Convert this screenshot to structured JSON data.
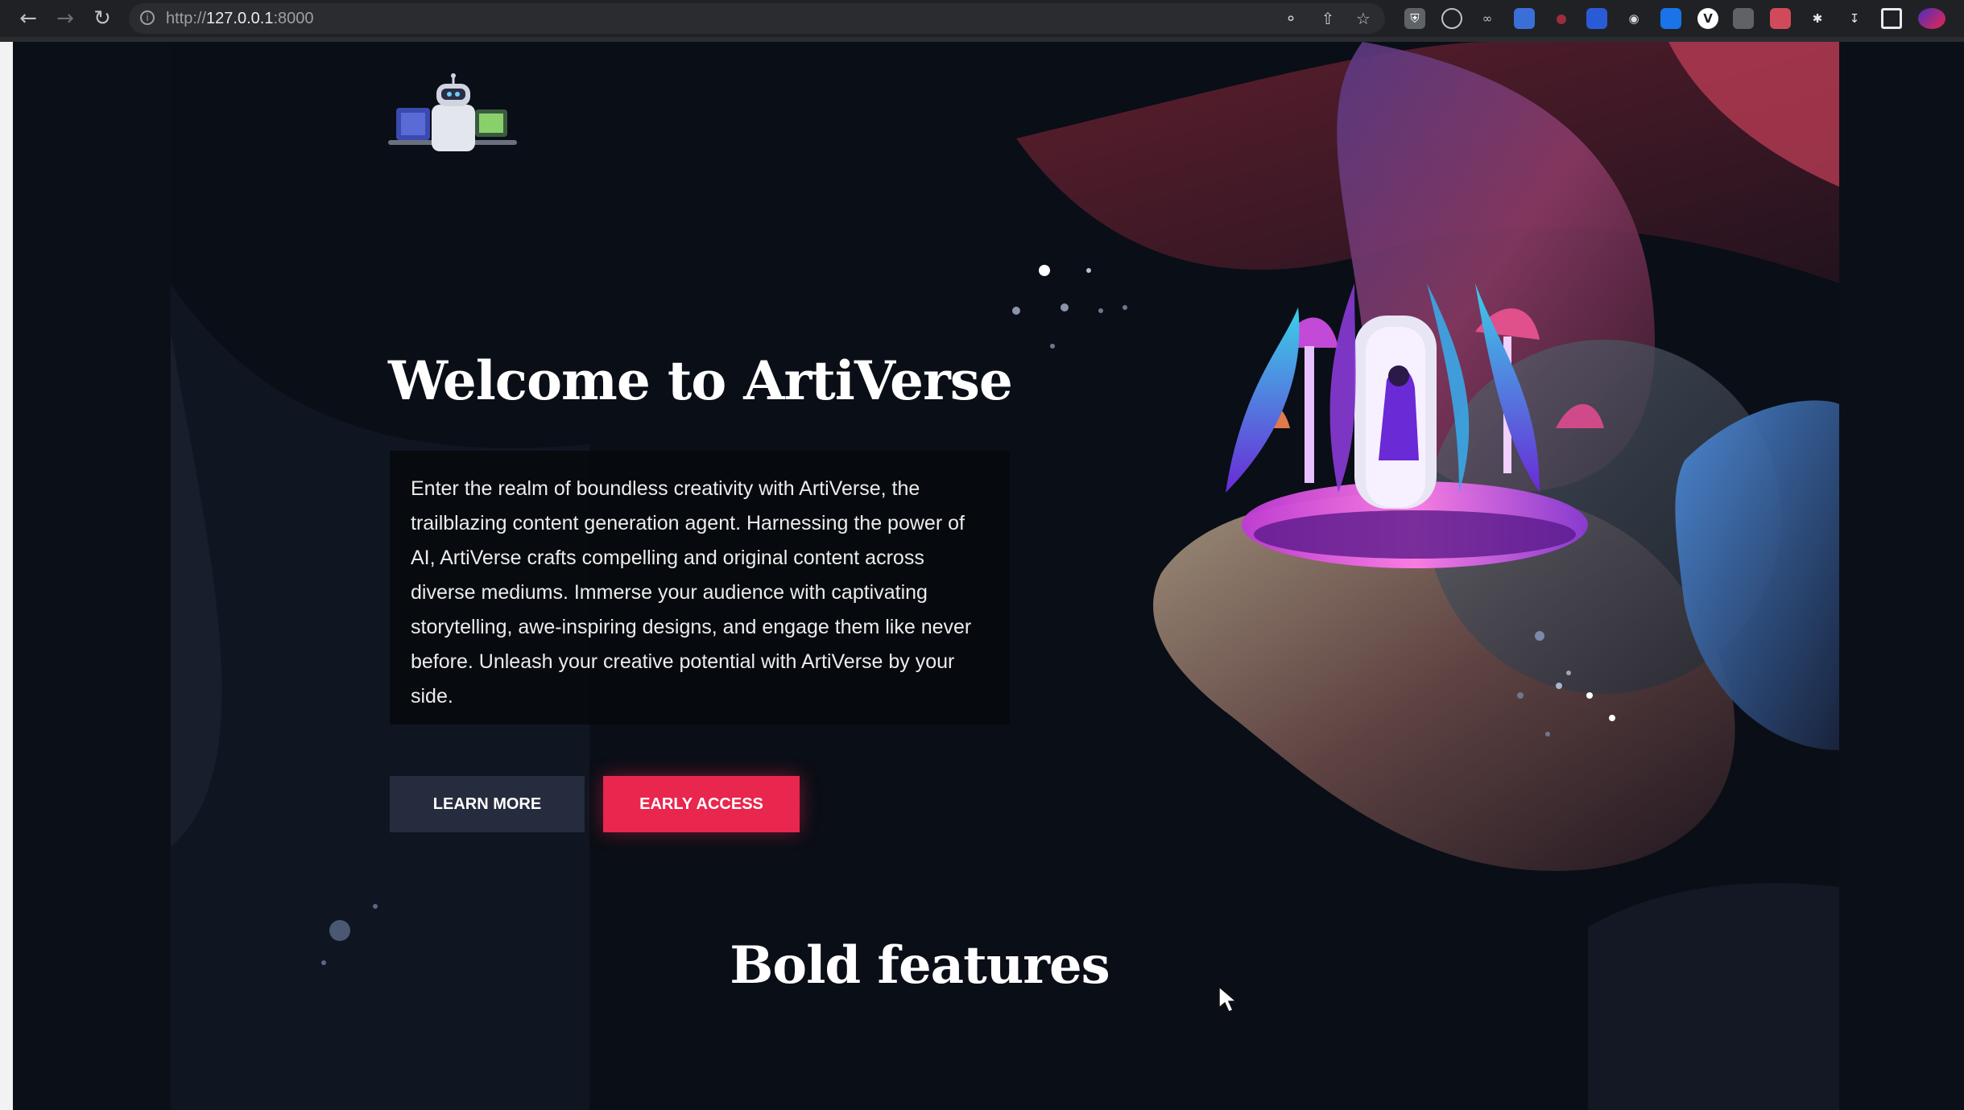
{
  "browser": {
    "url_scheme": "http://",
    "url_host": "127.0.0.1",
    "url_port": ":8000",
    "icons": {
      "back": "arrow-left-icon",
      "forward": "arrow-right-icon",
      "reload": "reload-icon",
      "info": "info-icon",
      "key": "key-icon",
      "share": "share-icon",
      "bookmark": "star-icon"
    }
  },
  "hero": {
    "title": "Welcome to ArtiVerse",
    "description": "Enter the realm of boundless creativity with ArtiVerse, the trailblazing content generation agent. Harnessing the power of AI, ArtiVerse crafts compelling and original content across diverse mediums. Immerse your audience with captivating storytelling, awe-inspiring designs, and engage them like never before. Unleash your creative potential with ArtiVerse by your side.",
    "learn_more_label": "LEARN MORE",
    "early_access_label": "EARLY ACCESS"
  },
  "features": {
    "title": "Bold features"
  },
  "colors": {
    "accent": "#e8264e",
    "secondary_button": "#252c3d",
    "background": "#0a0e16"
  }
}
